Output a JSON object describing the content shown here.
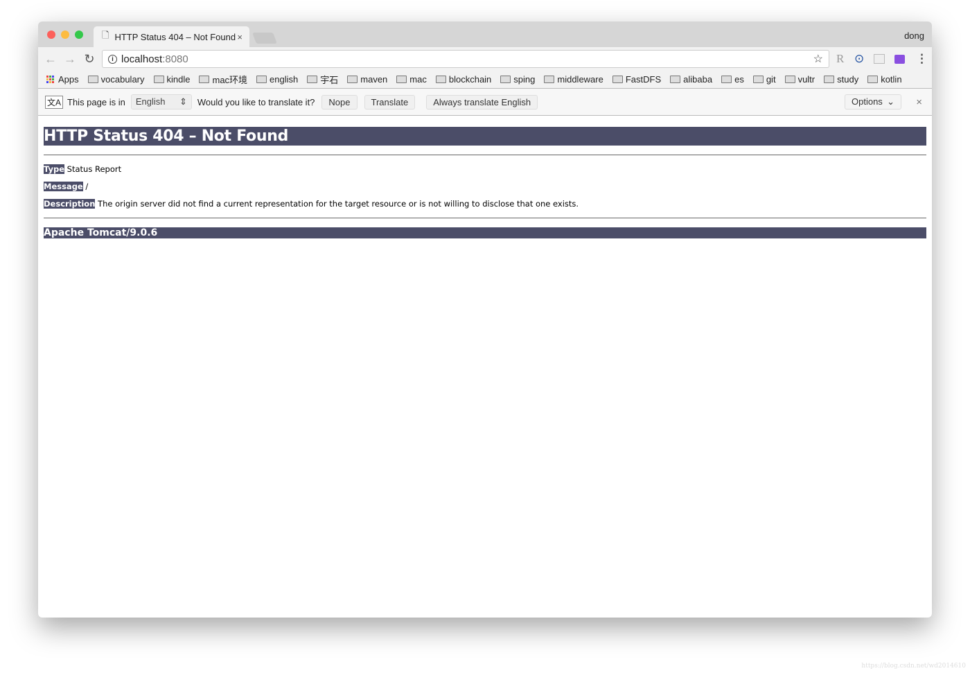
{
  "browser": {
    "tab_title": "HTTP Status 404 – Not Found",
    "tab_close": "×",
    "user": "dong",
    "url_host": "localhost",
    "url_port": ":8080",
    "extensions": [
      "bookmark-star-icon",
      "r-extension-icon",
      "play-extension-icon",
      "reader-extension-icon",
      "puzzle-extension-icon",
      "menu-icon"
    ],
    "bookmarks": [
      "Apps",
      "vocabulary",
      "kindle",
      "mac环境",
      "english",
      "宇石",
      "maven",
      "mac",
      "blockchain",
      "sping",
      "middleware",
      "FastDFS",
      "alibaba",
      "es",
      "git",
      "vultr",
      "study",
      "kotlin"
    ]
  },
  "translate": {
    "prefix": "This page is in",
    "language": "English",
    "question": "Would you like to translate it?",
    "nope": "Nope",
    "translate": "Translate",
    "always": "Always translate English",
    "options": "Options",
    "close": "×"
  },
  "page": {
    "title": "HTTP Status 404 – Not Found",
    "type_label": "Type",
    "type_value": " Status Report",
    "message_label": "Message",
    "message_value": " /",
    "description_label": "Description",
    "description_value": " The origin server did not find a current representation for the target resource or is not willing to disclose that one exists.",
    "footer": "Apache Tomcat/9.0.6"
  },
  "watermark": "https://blog.csdn.net/wd2014610",
  "colors": {
    "tomcat_header": "#4b4d68"
  }
}
